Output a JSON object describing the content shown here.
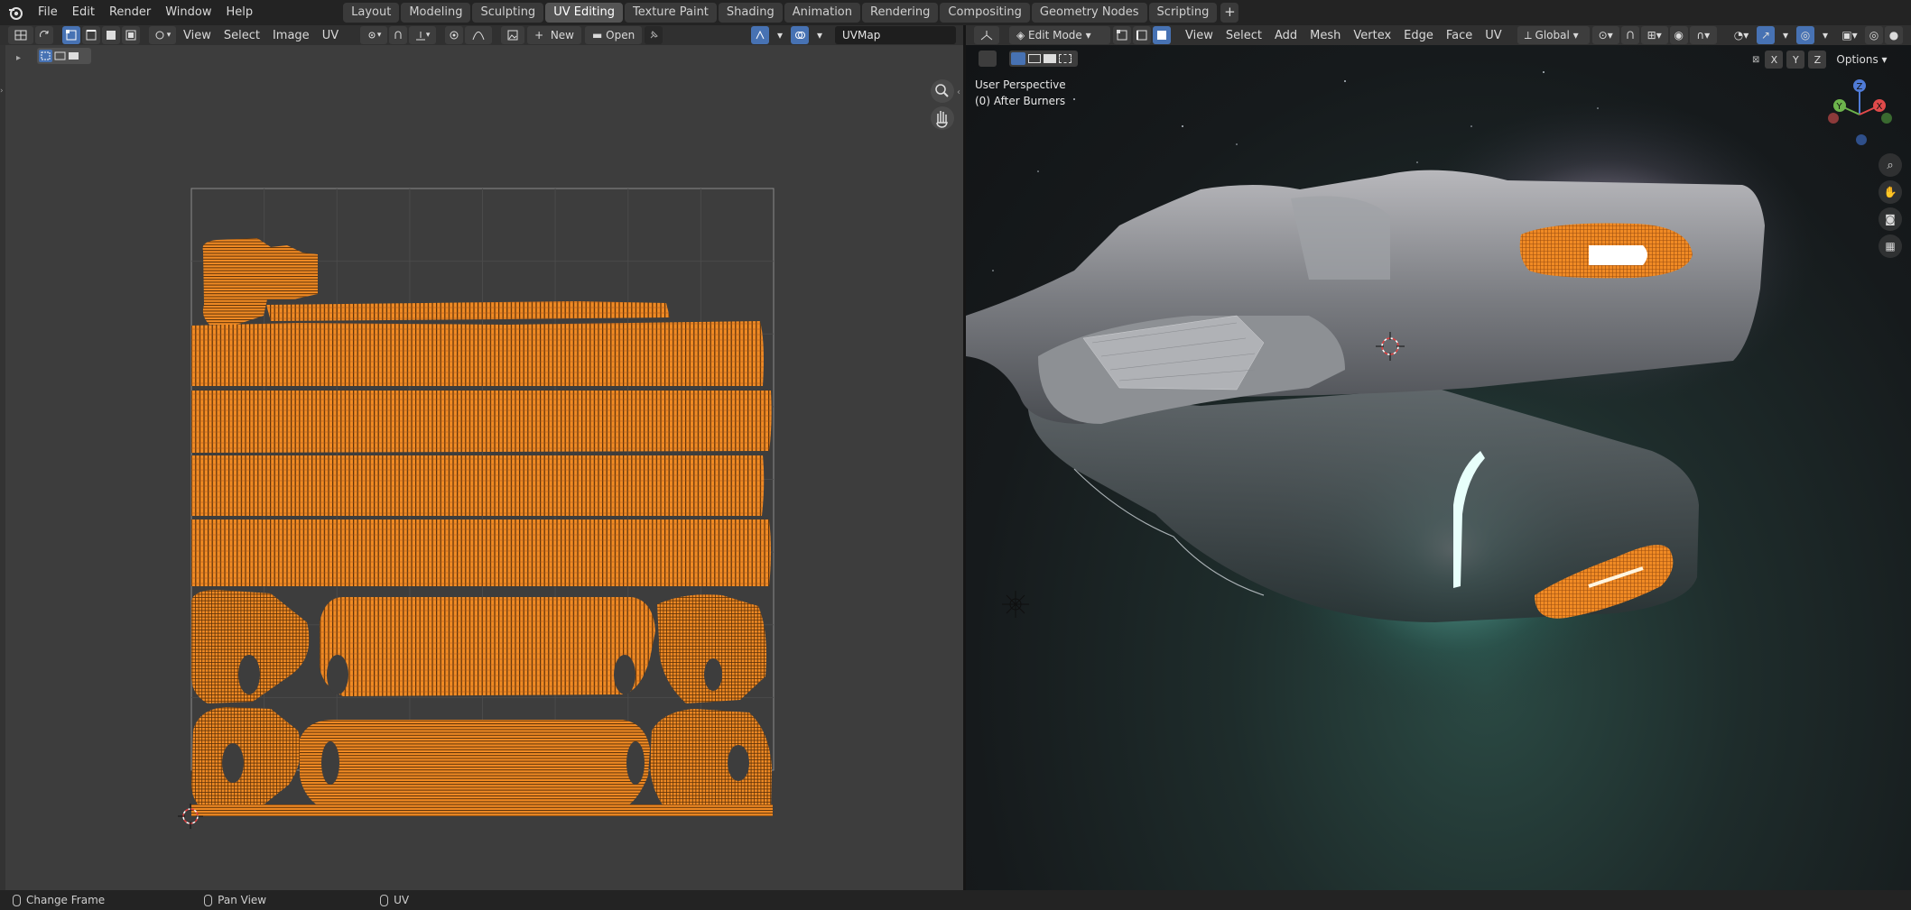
{
  "menus": [
    "File",
    "Edit",
    "Render",
    "Window",
    "Help"
  ],
  "workspaces": [
    {
      "label": "Layout",
      "active": false
    },
    {
      "label": "Modeling",
      "active": false
    },
    {
      "label": "Sculpting",
      "active": false
    },
    {
      "label": "UV Editing",
      "active": true
    },
    {
      "label": "Texture Paint",
      "active": false
    },
    {
      "label": "Shading",
      "active": false
    },
    {
      "label": "Animation",
      "active": false
    },
    {
      "label": "Rendering",
      "active": false
    },
    {
      "label": "Compositing",
      "active": false
    },
    {
      "label": "Geometry Nodes",
      "active": false
    },
    {
      "label": "Scripting",
      "active": false
    }
  ],
  "uv_editor": {
    "menus": [
      "View",
      "Select",
      "Image",
      "UV"
    ],
    "new_label": "New",
    "open_label": "Open",
    "uvmap_name": "UVMap"
  },
  "viewport": {
    "mode": "Edit Mode",
    "menus": [
      "View",
      "Select",
      "Add",
      "Mesh",
      "Vertex",
      "Edge",
      "Face",
      "UV"
    ],
    "transform_orientation": "Global",
    "axis_x": "X",
    "axis_y": "Y",
    "axis_z": "Z",
    "options_label": "Options",
    "perspective_label": "User Perspective",
    "object_label": "(0) After Burners",
    "gizmo_x": "X",
    "gizmo_y": "Y",
    "gizmo_z": "Z"
  },
  "statusbar": {
    "items": [
      "Change Frame",
      "Pan View",
      "UV"
    ]
  },
  "colors": {
    "accent": "#4772b3",
    "uv_wire": "#f08a24",
    "active_tab": "#545454"
  }
}
